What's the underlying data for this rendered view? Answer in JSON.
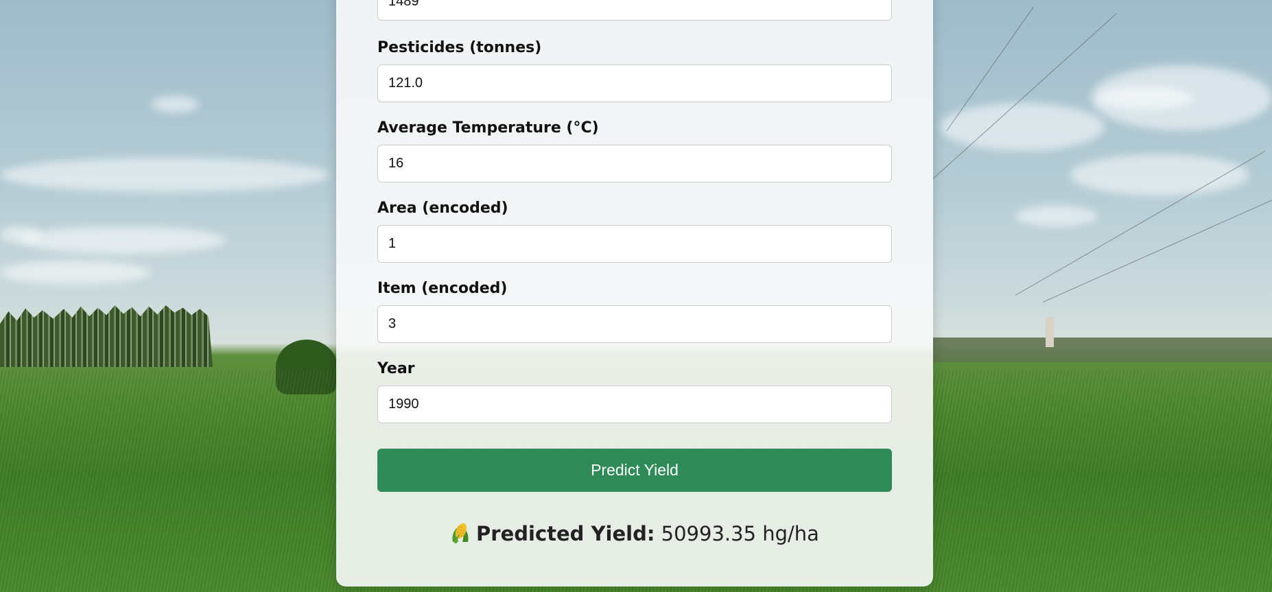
{
  "form": {
    "fields": [
      {
        "id": "rainfall",
        "label": "",
        "value": "1489"
      },
      {
        "id": "pesticides",
        "label": "Pesticides (tonnes)",
        "value": "121.0"
      },
      {
        "id": "avg_temp",
        "label": "Average Temperature (°C)",
        "value": "16"
      },
      {
        "id": "area",
        "label": "Area (encoded)",
        "value": "1"
      },
      {
        "id": "item",
        "label": "Item (encoded)",
        "value": "3"
      },
      {
        "id": "year",
        "label": "Year",
        "value": "1990"
      }
    ],
    "submit_label": "Predict Yield"
  },
  "result": {
    "icon": "corn-icon",
    "label": "Predicted Yield:",
    "value": "50993.35 hg/ha"
  },
  "colors": {
    "button": "#2e8b57",
    "button_text": "#ffffff",
    "card": "#f8faf9"
  }
}
